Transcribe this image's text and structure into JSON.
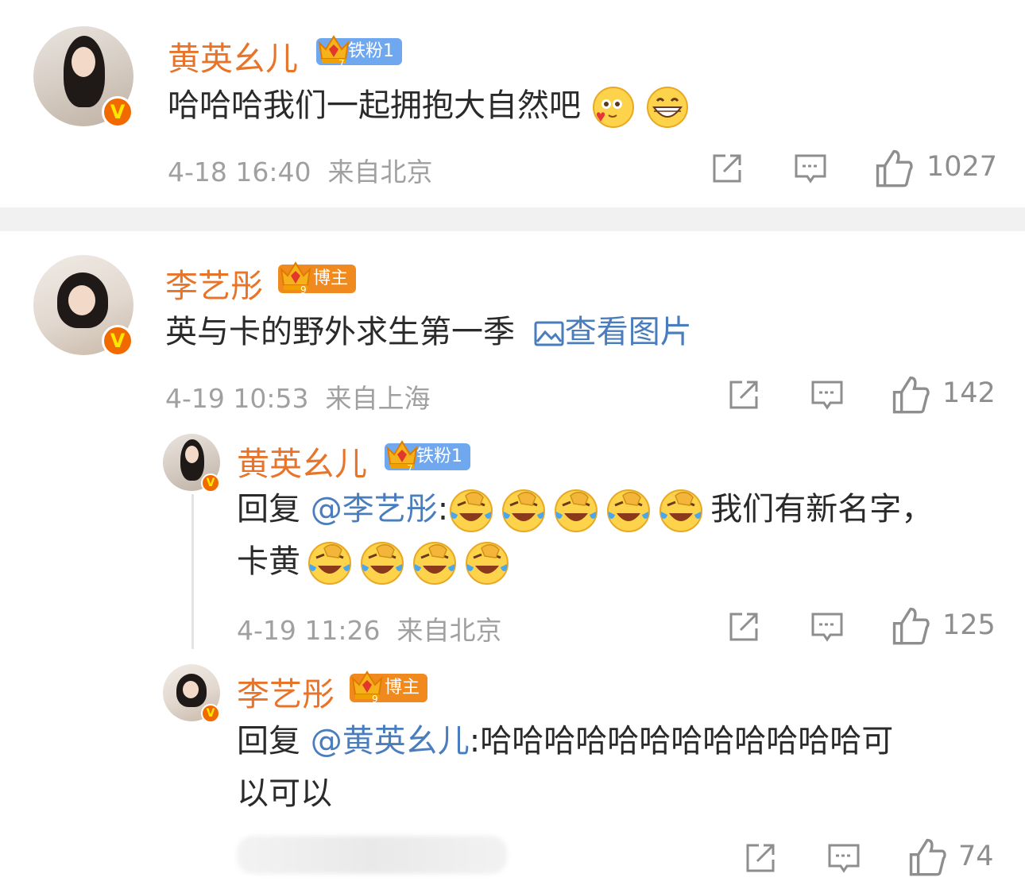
{
  "comments": [
    {
      "username": "黄英幺儿",
      "badge": "铁粉1",
      "text": "哈哈哈我们一起拥抱大自然吧",
      "time": "4-18 16:40",
      "location": "来自北京",
      "likes": "1027"
    },
    {
      "username": "李艺彤",
      "badge": "博主",
      "text": "英与卡的野外求生第一季",
      "view_image": "查看图片",
      "time": "4-19 10:53",
      "location": "来自上海",
      "likes": "142",
      "replies": [
        {
          "username": "黄英幺儿",
          "badge": "铁粉1",
          "reply_prefix": "回复",
          "mention": "@李艺彤",
          "colon": ":",
          "text_line1": "我们有新名字，",
          "text_line2": "卡黄",
          "time": "4-19 11:26",
          "location": "来自北京",
          "likes": "125"
        },
        {
          "username": "李艺彤",
          "badge": "博主",
          "reply_prefix": "回复",
          "mention": "@黄英幺儿",
          "colon": ":",
          "text_line1": "哈哈哈哈哈哈哈哈哈哈哈哈可",
          "text_line2": "以可以",
          "likes": "74"
        }
      ]
    }
  ],
  "colors": {
    "username": "#e8742a",
    "link": "#4a7dbd",
    "meta": "#a0a0a0",
    "fan_badge": "#70a8ef",
    "blogger_badge": "#f08a1e"
  },
  "icons": [
    "share-icon",
    "comment-icon",
    "like-icon",
    "verified-icon",
    "crown-icon",
    "image-icon",
    "laughing-cry-emoji",
    "blush-emoji",
    "grin-emoji"
  ]
}
